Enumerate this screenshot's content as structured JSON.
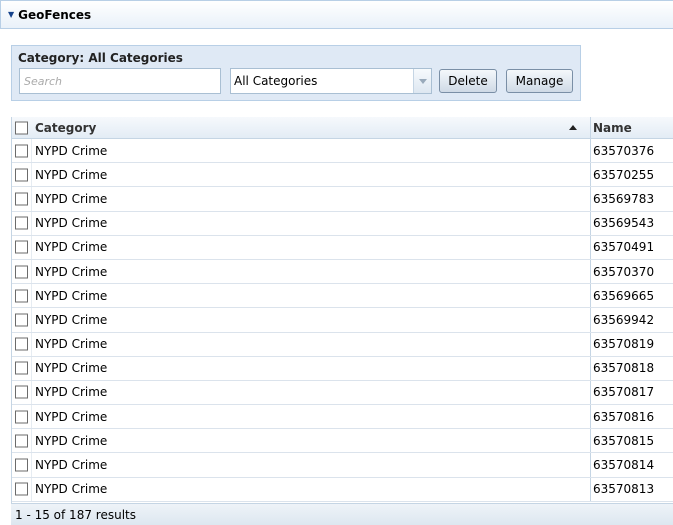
{
  "panel": {
    "title": "GeoFences",
    "collapse_icon": "triangle-down-icon"
  },
  "filter": {
    "title": "Category: All Categories",
    "search_placeholder": "Search",
    "search_value": "",
    "category_selected": "All Categories",
    "delete_label": "Delete",
    "manage_label": "Manage"
  },
  "grid": {
    "columns": {
      "category": "Category",
      "name": "Name"
    },
    "sort": {
      "column": "Category",
      "direction": "ascending"
    },
    "rows": [
      {
        "category": "NYPD Crime",
        "name": "63570376"
      },
      {
        "category": "NYPD Crime",
        "name": "63570255"
      },
      {
        "category": "NYPD Crime",
        "name": "63569783"
      },
      {
        "category": "NYPD Crime",
        "name": "63569543"
      },
      {
        "category": "NYPD Crime",
        "name": "63570491"
      },
      {
        "category": "NYPD Crime",
        "name": "63570370"
      },
      {
        "category": "NYPD Crime",
        "name": "63569665"
      },
      {
        "category": "NYPD Crime",
        "name": "63569942"
      },
      {
        "category": "NYPD Crime",
        "name": "63570819"
      },
      {
        "category": "NYPD Crime",
        "name": "63570818"
      },
      {
        "category": "NYPD Crime",
        "name": "63570817"
      },
      {
        "category": "NYPD Crime",
        "name": "63570816"
      },
      {
        "category": "NYPD Crime",
        "name": "63570815"
      },
      {
        "category": "NYPD Crime",
        "name": "63570814"
      },
      {
        "category": "NYPD Crime",
        "name": "63570813"
      }
    ]
  },
  "footer": {
    "results_text": "1 - 15 of 187 results"
  },
  "colors": {
    "accent": "#15428b",
    "header_border": "#b8cfe6",
    "filter_bg": "#dfe9f5"
  }
}
